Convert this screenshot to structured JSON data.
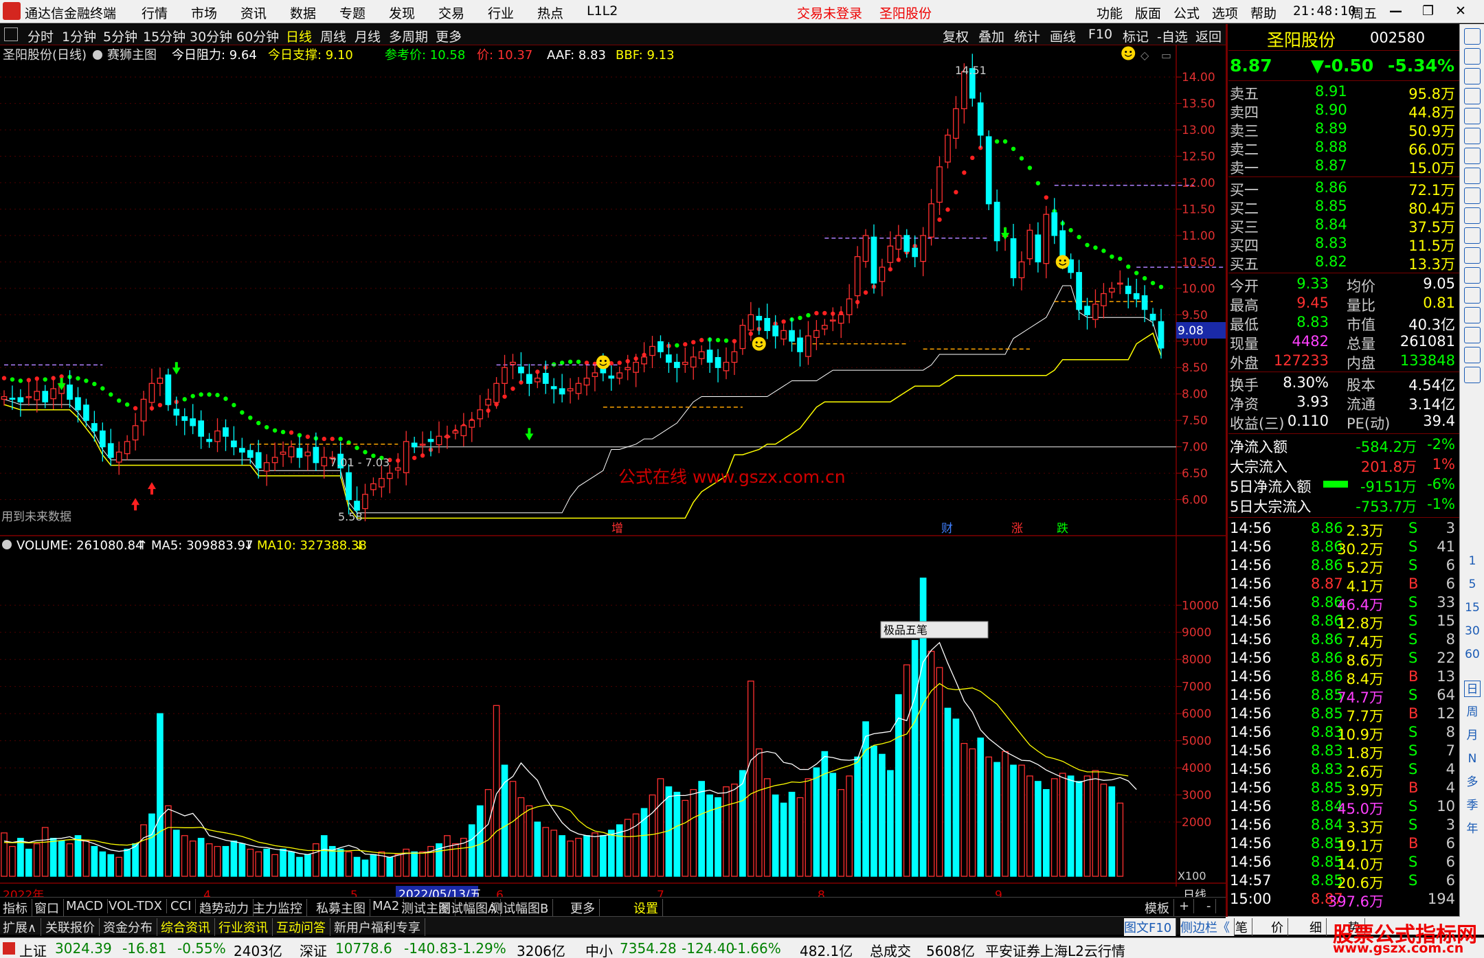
{
  "titlebar": {
    "app_title": "通达信金融终端",
    "menus": [
      "行情",
      "市场",
      "资讯",
      "数据",
      "专题",
      "发现",
      "交易",
      "行业",
      "热点",
      "L1L2"
    ],
    "login": "交易未登录",
    "stock": "圣阳股份",
    "right_menus": [
      "功能",
      "版面",
      "公式",
      "选项",
      "帮助"
    ],
    "clock": "21:48:10",
    "weekday": "周五"
  },
  "periodbar": {
    "periods": [
      "分时",
      "1分钟",
      "5分钟",
      "15分钟",
      "30分钟",
      "60分钟",
      "日线",
      "周线",
      "月线",
      "多周期",
      "更多"
    ],
    "tools": [
      "复权",
      "叠加",
      "统计",
      "画线",
      "F10",
      "标记",
      "-自选",
      "返回"
    ]
  },
  "chart_header": {
    "name": "圣阳股份(日线)",
    "indicator": "赛狮主图",
    "resist": "今日阻力: 9.64",
    "support": "今日支撑: 9.10",
    "ref": "参考价: 10.58",
    "price": "价: 10.37",
    "aaf": "AAF: 8.83",
    "bbf": "BBF: 9.13"
  },
  "chart_data": [
    {
      "type": "candlestick",
      "price_axis": [
        "14.00",
        "13.50",
        "13.00",
        "12.50",
        "12.00",
        "11.50",
        "11.00",
        "10.50",
        "10.00",
        "9.50",
        "9.00",
        "8.50",
        "8.00",
        "7.50",
        "7.00",
        "6.50",
        "6.00"
      ],
      "ylim": [
        5.5,
        14.6
      ],
      "high_label": "14.51",
      "low_label": "5.58",
      "range_label": "7.01 - 7.03",
      "current_price_label": "9.08",
      "annotation_left": "用到未来数据",
      "watermark": "公式在线  www.gszx.com.cn",
      "events": [
        "增",
        "财",
        "涨",
        "跌"
      ],
      "date_axis": [
        "2022年",
        "4",
        "5",
        "2022/05/13/五",
        "6",
        "7",
        "8",
        "9",
        "日线"
      ],
      "closes": [
        7.95,
        7.9,
        7.85,
        7.95,
        8.05,
        7.85,
        8.1,
        8.2,
        7.9,
        7.7,
        7.5,
        7.3,
        7.0,
        6.8,
        6.9,
        7.1,
        7.4,
        7.9,
        8.2,
        8.3,
        7.8,
        7.6,
        7.5,
        7.4,
        7.2,
        7.1,
        7.3,
        7.2,
        7.0,
        6.9,
        6.8,
        6.6,
        6.7,
        6.8,
        6.9,
        7.0,
        6.8,
        6.9,
        6.7,
        6.8,
        6.8,
        6.6,
        6.0,
        5.8,
        6.1,
        6.3,
        6.4,
        6.5,
        6.6,
        7.1,
        7.0,
        7.05,
        7.1,
        7.2,
        7.2,
        7.3,
        7.4,
        7.5,
        7.7,
        7.9,
        8.2,
        8.5,
        8.6,
        8.4,
        8.2,
        8.3,
        8.2,
        8.1,
        8.0,
        8.1,
        8.2,
        8.3,
        8.4,
        8.4,
        8.3,
        8.4,
        8.5,
        8.6,
        8.7,
        8.9,
        8.8,
        8.6,
        8.5,
        8.6,
        8.7,
        8.8,
        8.6,
        8.5,
        8.6,
        8.8,
        9.3,
        9.5,
        9.4,
        9.2,
        9.1,
        9.2,
        9.0,
        8.8,
        9.1,
        9.2,
        9.3,
        9.4,
        9.5,
        9.8,
        10.6,
        11.0,
        10.1,
        10.4,
        10.8,
        11.0,
        10.7,
        10.6,
        11.0,
        11.6,
        12.3,
        12.9,
        13.4,
        14.1,
        13.6,
        12.9,
        11.6,
        10.9,
        11.0,
        10.2,
        10.5,
        11.1,
        10.5,
        11.4,
        11.0,
        10.6,
        10.3,
        9.6,
        9.5,
        9.7,
        9.9,
        10.0,
        10.1,
        9.9,
        9.8,
        9.6,
        9.4,
        8.87
      ]
    },
    {
      "type": "bar",
      "title": "VOLUME: 261080.84",
      "series": [
        {
          "name": "MA5: 309883.97"
        },
        {
          "name": "MA10: 327388.38"
        }
      ],
      "scale_label": "X100",
      "y_axis": [
        "10000",
        "9000",
        "8000",
        "7000",
        "6000",
        "5000",
        "4000",
        "3000",
        "2000"
      ],
      "ylim": [
        0,
        11400
      ],
      "values": [
        1600,
        1100,
        1400,
        1000,
        1200,
        1800,
        1400,
        1300,
        1200,
        1500,
        1300,
        1100,
        900,
        800,
        700,
        1000,
        1200,
        1900,
        2300,
        6000,
        2600,
        1700,
        1500,
        1300,
        1400,
        1200,
        1100,
        1100,
        1300,
        1200,
        1000,
        900,
        1000,
        800,
        1000,
        900,
        700,
        800,
        1200,
        1500,
        1100,
        1000,
        900,
        700,
        600,
        800,
        900,
        700,
        800,
        1000,
        900,
        900,
        1100,
        1200,
        1500,
        1200,
        1400,
        1900,
        2600,
        3200,
        6300,
        4100,
        3500,
        2900,
        2600,
        2000,
        1800,
        1700,
        1500,
        1300,
        1400,
        1500,
        1600,
        1500,
        1700,
        1900,
        2100,
        2300,
        2500,
        3000,
        3600,
        3300,
        3100,
        2800,
        3200,
        3500,
        3000,
        2900,
        3300,
        3400,
        3900,
        7200,
        4700,
        3600,
        3000,
        2700,
        3100,
        2900,
        3600,
        4000,
        4600,
        3800,
        3200,
        3700,
        4400,
        5700,
        4800,
        4500,
        3900,
        6700,
        7800,
        8700,
        11000,
        8300,
        7700,
        6200,
        5800,
        4900,
        4700,
        5100,
        4400,
        4200,
        4600,
        4100,
        4100,
        3700,
        3500,
        3200,
        3600,
        3800,
        3700,
        3500,
        3700,
        3900,
        3400,
        3300,
        2700
      ],
      "colors": "rrccrrccrcrcccrccrccrcrrcrrcccrrcrccccrcccrcccrcrrcrrcrrrccrrcrrrcrrcrrcrcccrrcrrccrrcccrrcrrrcccrrcccrrccccccrccrrccrrcrcrcrrccrrccrrrcrcrcrcrcrrccrc",
      "ma5": [
        1300,
        1250,
        1300,
        1250,
        1320,
        1340,
        1380,
        1400,
        1460,
        1330,
        1300,
        1200,
        1080,
        970,
        920,
        960,
        1100,
        1420,
        1540,
        2180,
        2480,
        2360,
        2230,
        2320,
        1960,
        1500,
        1420,
        1330,
        1280,
        1220,
        1140,
        1080,
        1060,
        1000,
        960,
        920,
        840,
        800,
        880,
        1000,
        960,
        1060,
        1140,
        1040,
        820,
        800,
        760,
        700,
        780,
        840,
        860,
        860,
        920,
        1020,
        1100,
        1160,
        1220,
        1360,
        1640,
        1920,
        3040,
        3460,
        3680,
        4180,
        3840,
        3540,
        2880,
        2420,
        1980,
        1700,
        1560,
        1500,
        1460,
        1500,
        1540,
        1620,
        1700,
        1860,
        2100,
        2340,
        2660,
        2940,
        2980,
        2980,
        3040,
        3120,
        3180,
        3060,
        3080,
        3200,
        3420,
        4280,
        4540,
        4600,
        4540,
        4200,
        4140,
        3940,
        3940,
        4140,
        4420,
        4380,
        4300,
        4280,
        4320,
        5160,
        5260,
        5300,
        5340,
        5840,
        5740,
        6600,
        7900,
        8340,
        8620,
        7860,
        7180,
        6460,
        6060,
        5400,
        5080,
        4840,
        4600,
        4440,
        4280,
        4260,
        4120,
        3920,
        3780,
        3640,
        3540,
        3460,
        3550,
        3600,
        3540,
        3560,
        3640,
        3520,
        3200
      ],
      "ma10": [
        1250,
        1240,
        1250,
        1230,
        1250,
        1260,
        1290,
        1320,
        1350,
        1350,
        1340,
        1320,
        1250,
        1190,
        1160,
        1150,
        1200,
        1330,
        1430,
        1650,
        1800,
        1800,
        1790,
        1790,
        1810,
        1710,
        1650,
        1600,
        1540,
        1470,
        1370,
        1260,
        1200,
        1130,
        1090,
        1050,
        990,
        950,
        950,
        950,
        930,
        930,
        940,
        960,
        930,
        890,
        860,
        850,
        840,
        860,
        850,
        850,
        880,
        930,
        970,
        1010,
        1040,
        1080,
        1180,
        1340,
        1660,
        1840,
        2020,
        2260,
        2460,
        2560,
        2620,
        2620,
        2560,
        2420,
        2060,
        1820,
        1670,
        1620,
        1520,
        1480,
        1460,
        1480,
        1510,
        1540,
        1600,
        1680,
        1850,
        1970,
        2160,
        2300,
        2420,
        2520,
        2620,
        2700,
        2790,
        3040,
        3170,
        3260,
        3350,
        3400,
        3480,
        3460,
        3520,
        3630,
        3780,
        3880,
        3990,
        4080,
        4200,
        4650,
        4830,
        4890,
        4970,
        5140,
        5250,
        5710,
        6360,
        6840,
        7110,
        6920,
        6880,
        6910,
        6950,
        6820,
        6580,
        6350,
        5970,
        5590,
        5210,
        4840,
        4610,
        4410,
        4340,
        4240,
        4080,
        3930,
        3850,
        3850,
        3850,
        3790,
        3750,
        3700
      ]
    }
  ],
  "volume_header": {
    "volume": "VOLUME: 261080.84",
    "ma5": "MA5: 309883.97",
    "ma10": "MA10: 327388.38",
    "scale": "X100"
  },
  "float_widget": {
    "label": "极品五笔"
  },
  "bottom_tabs1": [
    "指标",
    "窗口",
    "MACD",
    "VOL-TDX",
    "CCI",
    "趋势动力",
    "主力监控",
    "私募主图",
    "MA2",
    "测试主图",
    "测试幅图A",
    "测试幅图B",
    "更多",
    "设置",
    "模板",
    "+",
    "-"
  ],
  "bottom_tabs2": [
    "扩展∧",
    "关联报价",
    "资金分布",
    "综合资讯",
    "行业资讯",
    "互动问答",
    "新用户福利专享"
  ],
  "bottom_tabs2_right": [
    "图文F10",
    "侧边栏《",
    "笔",
    "价",
    "细",
    "势"
  ],
  "quote": {
    "name": "圣阳股份",
    "code": "002580",
    "price": "8.87",
    "change": "▼-0.50",
    "pct": "-5.34%",
    "asks": [
      {
        "label": "卖五",
        "price": "8.91",
        "vol": "95.8万"
      },
      {
        "label": "卖四",
        "price": "8.90",
        "vol": "44.8万"
      },
      {
        "label": "卖三",
        "price": "8.89",
        "vol": "50.9万"
      },
      {
        "label": "卖二",
        "price": "8.88",
        "vol": "66.0万"
      },
      {
        "label": "卖一",
        "price": "8.87",
        "vol": "15.0万"
      }
    ],
    "bids": [
      {
        "label": "买一",
        "price": "8.86",
        "vol": "72.1万"
      },
      {
        "label": "买二",
        "price": "8.85",
        "vol": "80.4万"
      },
      {
        "label": "买三",
        "price": "8.84",
        "vol": "37.5万"
      },
      {
        "label": "买四",
        "price": "8.83",
        "vol": "11.5万"
      },
      {
        "label": "买五",
        "price": "8.82",
        "vol": "13.3万"
      }
    ],
    "stats": [
      [
        "今开",
        "9.33",
        "均价",
        "9.05"
      ],
      [
        "最高",
        "9.45",
        "量比",
        "0.81"
      ],
      [
        "最低",
        "8.83",
        "市值",
        "40.3亿"
      ],
      [
        "现量",
        "4482",
        "总量",
        "261081"
      ],
      [
        "外盘",
        "127233",
        "内盘",
        "133848"
      ],
      [
        "换手",
        "8.30%",
        "股本",
        "4.54亿"
      ],
      [
        "净资",
        "3.93",
        "流通",
        "3.14亿"
      ],
      [
        "收益(三)",
        "0.110",
        "PE(动)",
        "39.4"
      ]
    ],
    "flows": [
      [
        "净流入额",
        "-584.2万",
        "-2%"
      ],
      [
        "大宗流入",
        "201.8万",
        "1%"
      ],
      [
        "5日净流入额",
        "-9151万",
        "-6%"
      ],
      [
        "5日大宗流入",
        "-753.7万",
        "-1%"
      ]
    ],
    "ticks": [
      [
        "14:56",
        "8.86",
        "2.3万",
        "S",
        "3"
      ],
      [
        "14:56",
        "8.86",
        "30.2万",
        "S",
        "41"
      ],
      [
        "14:56",
        "8.86",
        "5.2万",
        "S",
        "6"
      ],
      [
        "14:56",
        "8.87",
        "4.1万",
        "B",
        "6"
      ],
      [
        "14:56",
        "8.86",
        "46.4万",
        "S",
        "33"
      ],
      [
        "14:56",
        "8.86",
        "12.8万",
        "S",
        "15"
      ],
      [
        "14:56",
        "8.86",
        "7.4万",
        "S",
        "8"
      ],
      [
        "14:56",
        "8.86",
        "8.6万",
        "S",
        "22"
      ],
      [
        "14:56",
        "8.86",
        "8.4万",
        "B",
        "13"
      ],
      [
        "14:56",
        "8.85",
        "74.7万",
        "S",
        "64"
      ],
      [
        "14:56",
        "8.85",
        "7.7万",
        "B",
        "12"
      ],
      [
        "14:56",
        "8.83",
        "10.9万",
        "S",
        "8"
      ],
      [
        "14:56",
        "8.83",
        "1.8万",
        "S",
        "7"
      ],
      [
        "14:56",
        "8.83",
        "2.6万",
        "S",
        "4"
      ],
      [
        "14:56",
        "8.85",
        "3.9万",
        "B",
        "4"
      ],
      [
        "14:56",
        "8.84",
        "45.0万",
        "S",
        "10"
      ],
      [
        "14:56",
        "8.84",
        "3.3万",
        "S",
        "3"
      ],
      [
        "14:56",
        "8.85",
        "19.1万",
        "B",
        "6"
      ],
      [
        "14:56",
        "8.85",
        "14.0万",
        "S",
        "6"
      ],
      [
        "14:57",
        "8.85",
        "20.6万",
        "S",
        "6"
      ],
      [
        "15:00",
        "8.87",
        "397.6万",
        "",
        "194"
      ]
    ]
  },
  "sidebar": {
    "items": [
      "日",
      "周",
      "月",
      "N",
      "多",
      "季",
      "年"
    ],
    "numbers": [
      "1",
      "5",
      "15",
      "30",
      "60"
    ]
  },
  "statusbar": {
    "items": [
      "上证",
      "3024.39",
      "-16.81",
      "-0.55%",
      "2403亿",
      "深证",
      "10778.6",
      "-140.83",
      "-1.29%",
      "3206亿",
      "中小",
      "7354.28",
      "-124.40",
      "-1.66%",
      "482.1亿",
      "总成交",
      "5608亿",
      "平安证券上海L2云行情"
    ],
    "brand": "股票公式指标网",
    "brand_url": "www.gszx.com.cn"
  },
  "colors": {
    "up": "#ff3030",
    "down": "#00ffff",
    "ma5": "#ffffff",
    "ma10": "#ffff00",
    "label_yellow": "#ffff00",
    "label_green": "#00ff00",
    "label_red": "#ff3030",
    "label_magenta": "#ff40ff",
    "label_blue": "#4080ff"
  }
}
